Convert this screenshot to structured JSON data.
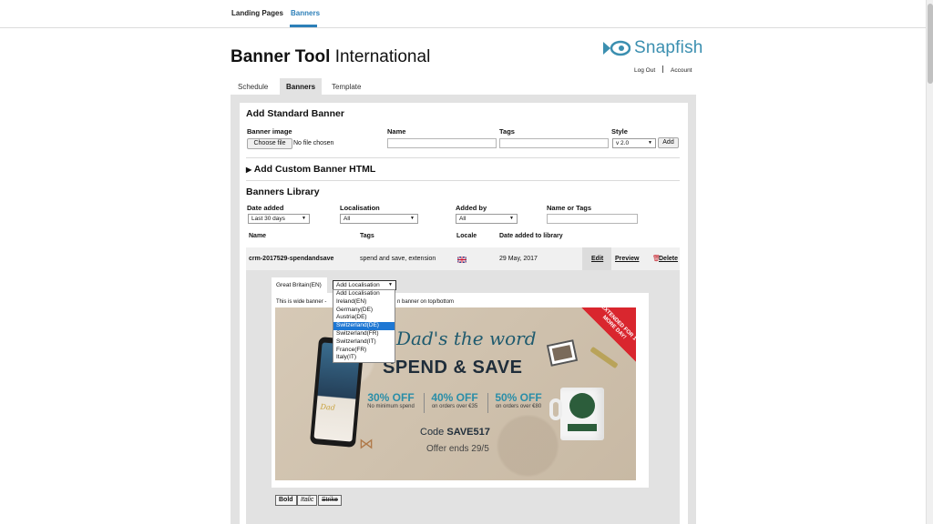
{
  "topnav": {
    "tabs": [
      {
        "label": "Landing Pages",
        "active": false
      },
      {
        "label": "Banners",
        "active": true
      }
    ]
  },
  "page": {
    "title_bold": "Banner Tool",
    "title_rest": " International",
    "logo_text": "Snapfish",
    "logout": "Log Out",
    "account": "Account"
  },
  "page_tabs": [
    {
      "label": "Schedule",
      "active": false
    },
    {
      "label": "Banners",
      "active": true
    },
    {
      "label": "Template",
      "active": false
    }
  ],
  "standard": {
    "heading": "Add Standard Banner",
    "image_label": "Banner image",
    "choose_file": "Choose file",
    "no_file": "No file chosen",
    "name_label": "Name",
    "tags_label": "Tags",
    "style_label": "Style",
    "style_value": "v 2.0",
    "add_button": "Add"
  },
  "custom": {
    "heading": "Add Custom Banner HTML"
  },
  "library": {
    "heading": "Banners Library",
    "filters": {
      "date_label": "Date added",
      "date_value": "Last 30 days",
      "loc_label": "Localisation",
      "loc_value": "All",
      "by_label": "Added by",
      "by_value": "All",
      "nametags_label": "Name or Tags"
    },
    "columns": [
      "Name",
      "Tags",
      "Locale",
      "Date added to library"
    ],
    "row": {
      "name": "crm-2017529-spendandsave",
      "tags": "spend and save, extension",
      "date": "29 May, 2017",
      "edit": "Edit",
      "preview": "Preview",
      "delete": "Delete"
    }
  },
  "detail": {
    "locale_tab": "Great Britain(EN)",
    "caption_left": "This is wide banner -",
    "caption_right": "n banner on top/bottom",
    "dropdown": {
      "selected": "Add Localisation",
      "options": [
        "Add Localisation",
        "Ireland(EN)",
        "Germany(DE)",
        "Austria(DE)",
        "Switzerland(DE)",
        "Switzerland(FR)",
        "Switzerland(IT)",
        "France(FR)",
        "Italy(IT)"
      ],
      "highlighted_index": 4
    },
    "format_buttons": [
      "Bold",
      "Italic",
      "Strike"
    ]
  },
  "banner": {
    "ribbon": "EXTENDED FOR 1 MORE DAY!",
    "script": "Dad's the word",
    "headline": "SPEND & SAVE",
    "offers": [
      {
        "pct": "30% OFF",
        "sub": "No minimum spend"
      },
      {
        "pct": "40% OFF",
        "sub": "on orders over €35"
      },
      {
        "pct": "50% OFF",
        "sub": "on orders over €80"
      }
    ],
    "code_prefix": "Code ",
    "code": "SAVE517",
    "ends": "Offer ends 29/5",
    "phone_text": "Dad"
  },
  "colors": {
    "accent": "#2c7fb8",
    "panel": "#e2e2e2",
    "highlight": "#1e77d3",
    "ribbon": "#d9262e"
  }
}
